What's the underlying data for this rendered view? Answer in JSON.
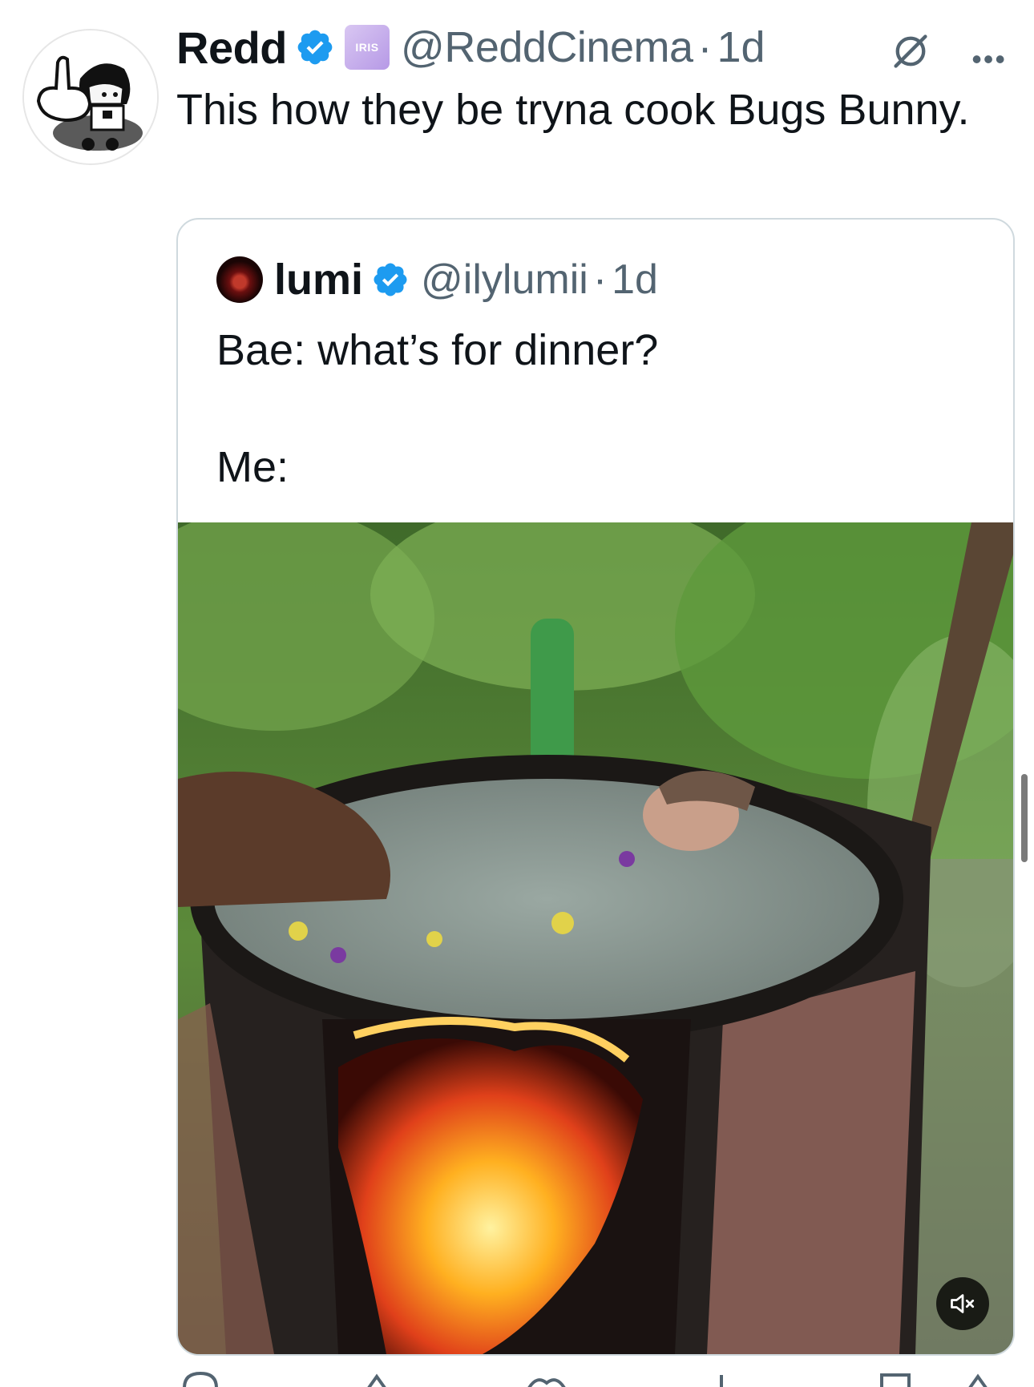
{
  "tweet": {
    "author_name": "Redd",
    "handle": "@ReddCinema",
    "separator": "·",
    "time": "1d",
    "affiliate_badge_text": "IRIS",
    "text": "This how they be tryna cook Bugs Bunny."
  },
  "quote": {
    "author_name": "lumi",
    "handle": "@ilylumii",
    "separator": "·",
    "time": "1d",
    "line1": "Bae: what’s for dinner?",
    "line2": "Me:"
  },
  "icons": {
    "verified": "verified-badge-icon",
    "grok": "grok-icon",
    "more": "more-icon",
    "mute": "muted-speaker-icon"
  },
  "colors": {
    "verified_blue": "#1d9bf0",
    "secondary_text": "#536471",
    "border": "#cfd9de"
  }
}
